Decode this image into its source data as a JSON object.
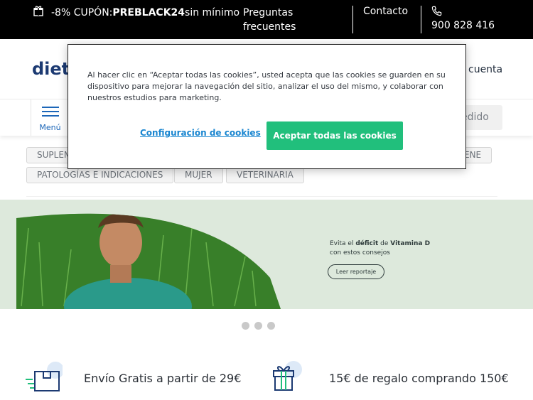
{
  "topbar": {
    "promo_prefix": "-8% CUPÓN: ",
    "promo_code": "PREBLACK24",
    "promo_suffix": " sin mínimo",
    "faq_label": "Preguntas frecuentes",
    "contact_label": "Contacto",
    "phone": "900 828 416"
  },
  "header": {
    "logo_text": "dieté",
    "account_label": "cuenta"
  },
  "nav": {
    "menu_label": "Menú",
    "order_label": "edido"
  },
  "categories": {
    "row1_left": "SUPLEM",
    "row1_right": "ENE",
    "row2": [
      "PATOLOGÍAS E INDICACIONES",
      "MUJER",
      "VETERINARIA"
    ]
  },
  "banner": {
    "line1_a": "Evita el ",
    "line1_b": "déficit",
    "line1_c": " de ",
    "line1_d": "Vitamina D",
    "line2": "con estos consejos",
    "button_label": "Leer reportaje"
  },
  "carousel": {
    "slides": 3
  },
  "features": [
    {
      "icon": "delivery-box-icon",
      "text": "Envío Gratis a partir de 29€"
    },
    {
      "icon": "gift-icon",
      "text": "15€ de regalo comprando 150€"
    }
  ],
  "cookie_banner": {
    "text": "Al hacer clic en “Aceptar todas las cookies”, usted acepta que las cookies se guarden en su dispositivo para mejorar la navegación del sitio, analizar el uso del mismo, y colaborar con nuestros estudios para marketing.",
    "settings_label": "Configuración de cookies",
    "accept_label": "Aceptar todas las cookies"
  },
  "colors": {
    "brand_blue": "#1c3a72",
    "accent_blue": "#1c66b8",
    "accept_green": "#21bf7c",
    "banner_bg": "#dde9dc"
  }
}
